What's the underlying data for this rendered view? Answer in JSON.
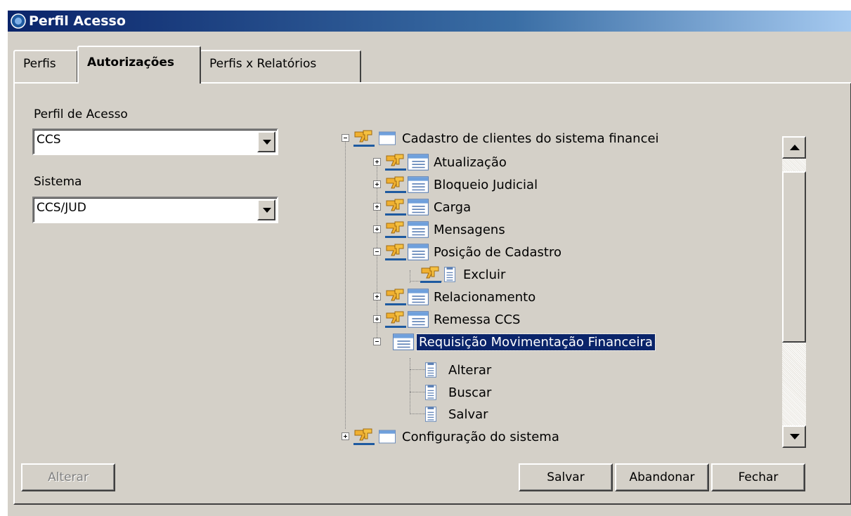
{
  "window": {
    "title": "Perfil Acesso"
  },
  "tabs": [
    {
      "label": "Perfis"
    },
    {
      "label": "Autorizações"
    },
    {
      "label": "Perfis x Relatórios"
    }
  ],
  "form": {
    "perfil_label": "Perfil de Acesso",
    "perfil_value": "CCS",
    "sistema_label": "Sistema",
    "sistema_value": "CCS/JUD"
  },
  "tree": {
    "root1": "Cadastro de clientes do sistema financei",
    "items": [
      "Atualização",
      "Bloqueio Judicial",
      "Carga",
      "Mensagens",
      "Posição de Cadastro",
      "Excluir",
      "Relacionamento",
      "Remessa CCS",
      "Requisição Movimentação Financeira",
      "Alterar",
      "Buscar",
      "Salvar"
    ],
    "root2": "Configuração do sistema"
  },
  "buttons": {
    "alterar": "Alterar",
    "salvar": "Salvar",
    "abandonar": "Abandonar",
    "fechar": "Fechar"
  },
  "colors": {
    "titlebar": "#0a246a",
    "selection": "#0a246a",
    "window_bg": "#d4d0c8",
    "access_icon": "#e8a317"
  }
}
